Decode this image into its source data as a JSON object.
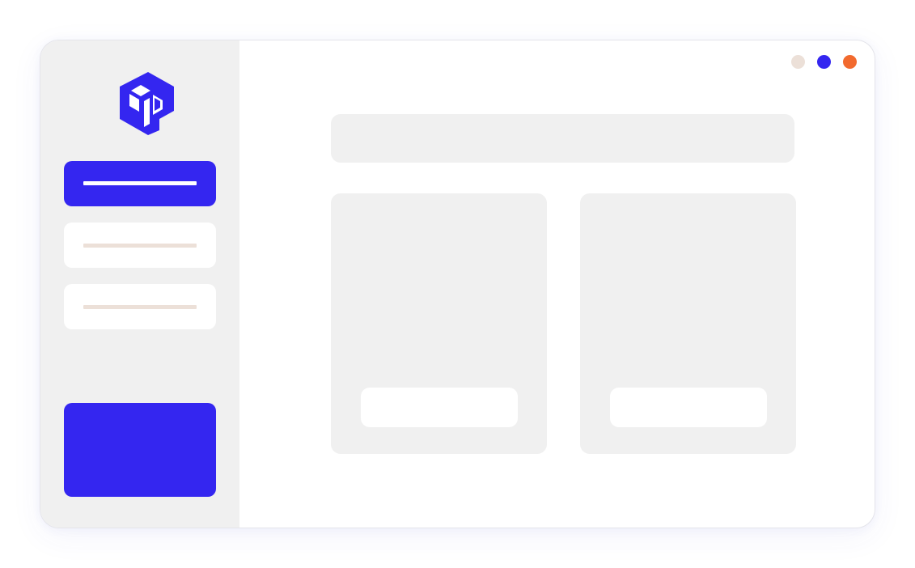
{
  "colors": {
    "accent": "#3426f0",
    "sidebar_bg": "#f0f0f0",
    "placeholder_bar": "#ece0d8",
    "dot_neutral": "#ece0d8",
    "dot_primary": "#3426f0",
    "dot_orange": "#f26a2e"
  },
  "sidebar": {
    "logo": "box-p-logo",
    "items": [
      {
        "state": "active"
      },
      {
        "state": "inactive"
      },
      {
        "state": "inactive"
      }
    ],
    "promo_card": {
      "state": "highlighted"
    }
  },
  "window_controls": {
    "icons": [
      "neutral-dot-icon",
      "blue-dot-icon",
      "orange-dot-icon"
    ]
  },
  "main": {
    "header": {
      "state": "placeholder"
    },
    "cards": [
      {
        "state": "placeholder"
      },
      {
        "state": "placeholder"
      }
    ]
  }
}
